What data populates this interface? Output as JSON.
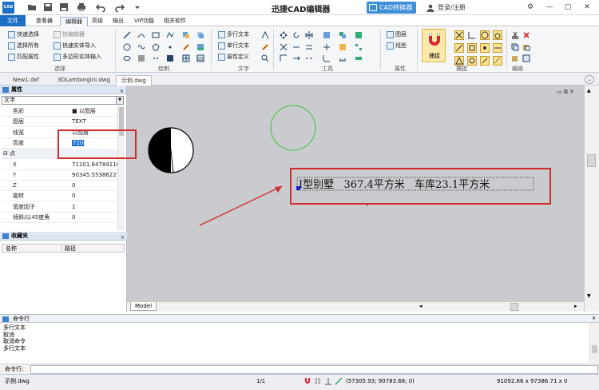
{
  "title_bar": {
    "title": "迅捷CAD编辑器",
    "converter_label": "CAD转换器",
    "login_label": "登录/注册",
    "logo_text": "CAD"
  },
  "menu": {
    "items": [
      "文件",
      "查看器",
      "编辑器",
      "高级",
      "输出",
      "VIP功能",
      "相关软件"
    ],
    "active": "编辑器"
  },
  "ribbon": {
    "select_group": {
      "label": "选择",
      "buttons": [
        "快速选择",
        "选择所有",
        "匹配属性",
        "快编辑器",
        "快速实体导入",
        "多边形实体输入"
      ]
    },
    "draw_group": {
      "label": "绘制"
    },
    "text_group": {
      "label": "文字",
      "buttons": [
        "多行文本",
        "单行文本",
        "属性定义"
      ]
    },
    "tools_group": {
      "label": "工具"
    },
    "props_group": {
      "label": "属性",
      "buttons": [
        "图层",
        "线型"
      ]
    },
    "snap_group": {
      "label": "捕捉",
      "snap_button": "捕捉"
    },
    "edit_group": {
      "label": "编辑"
    }
  },
  "doc_tabs": [
    "New1.dxf",
    "3DLamborgini.dwg",
    "示例.dwg"
  ],
  "properties": {
    "title": "属性",
    "object_type": "文字",
    "rows": [
      {
        "k": "色彩",
        "v": "■ 以图层"
      },
      {
        "k": "图层",
        "v": "TEXT"
      },
      {
        "k": "线宽",
        "v": "以图层"
      },
      {
        "k": "高度",
        "v": "720"
      },
      {
        "k": "点",
        "v": "",
        "group": true
      },
      {
        "k": "X",
        "v": "71101.847841101"
      },
      {
        "k": "Y",
        "v": "90345.553862273"
      },
      {
        "k": "Z",
        "v": "0"
      },
      {
        "k": "旋转",
        "v": "0"
      },
      {
        "k": "宽度因子",
        "v": "1"
      },
      {
        "k": "倾斜/以45度角",
        "v": "0"
      }
    ]
  },
  "favorites": {
    "title": "收藏夹",
    "columns": [
      "名称",
      "路径"
    ]
  },
  "drawing": {
    "text": "Ⅰ型别墅   367.4平方米   车库23.1平方米"
  },
  "model_tab": "Model",
  "command": {
    "title": "命令行",
    "log": [
      "多行文本",
      "取消",
      "取消命令",
      "多行文本"
    ],
    "prompt": "命令行:"
  },
  "status": {
    "file": "示例.dwg",
    "page": "1/1",
    "coords": "(57305.93; 90783.68; 0)",
    "size": "91092.66 x 97386.71 x 0"
  },
  "colors": {
    "accent": "#1c6fc4",
    "annotation": "#d22b2b",
    "circle": "#3cc23c"
  }
}
